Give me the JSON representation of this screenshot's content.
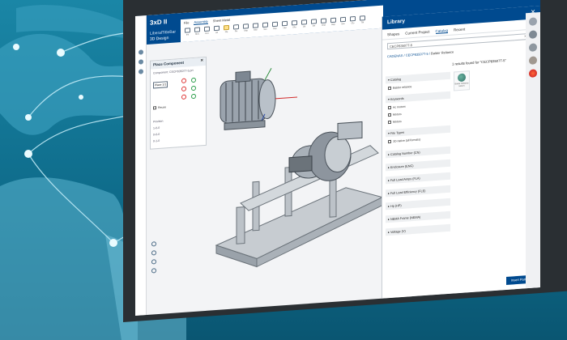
{
  "window": {
    "app_title": "3xD II",
    "app_subtitle": "LiberalTitleBar",
    "design_badge": "3D Design"
  },
  "ribbon": {
    "tabs": [
      "File",
      "Assembly",
      "Sheet Metal"
    ],
    "active_tab": "Assembly",
    "tools": [
      "Ins",
      "Mov",
      "Rot",
      "Ali",
      "Pla",
      "Fix",
      "Snp",
      "Msr",
      "Sec",
      "Exp",
      "Hid",
      "Sho",
      "Lib",
      "Ins",
      "Rnd",
      "Rep",
      "Sav",
      "Clo",
      "Tbl"
    ]
  },
  "place_component": {
    "title": "Place Component",
    "component_label": "Component: CECP83507T-5.prt",
    "button_label": "Place 1/1",
    "reuse_label": "Reuse",
    "position_label": "Position",
    "info_lines": [
      "1-0-0",
      "0-0-0",
      "0-1-0"
    ]
  },
  "library": {
    "title": "Library",
    "tabs": [
      "Shapes",
      "Current Project",
      "Catalog",
      "Recent"
    ],
    "active_tab": "Catalog",
    "search_value": "CECP83507T-5",
    "breadcrumbs": [
      "CADENAS",
      "CECP83507T-5",
      "Baldor Reliance"
    ],
    "results_text": "1 results found for \"CECP83507T-5\"",
    "thumb_caption": "Baldor Reliance Motors",
    "facets": {
      "catalog": {
        "title": "Catalog",
        "rows": [
          "Baldor reliance"
        ]
      },
      "keywords": {
        "title": "Keywords",
        "rows": [
          "Ac motors",
          "Motors",
          "Motors"
        ]
      },
      "filetypes": {
        "title": "File Types",
        "rows": [
          "3D native (all formats)"
        ]
      }
    },
    "collapsed_facets": [
      "Catalog Number (CN)",
      "Enclosure (ENC)",
      "Full Load Amps (FLA)",
      "Full Load Efficiency (FLE)",
      "Hp (HP)",
      "NEMA Frame (NEMA)",
      "Voltage (V)"
    ],
    "insert_button": "Insert Part"
  },
  "colors": {
    "brand_blue": "#004a8f",
    "background_teal": "#1a86a6"
  }
}
